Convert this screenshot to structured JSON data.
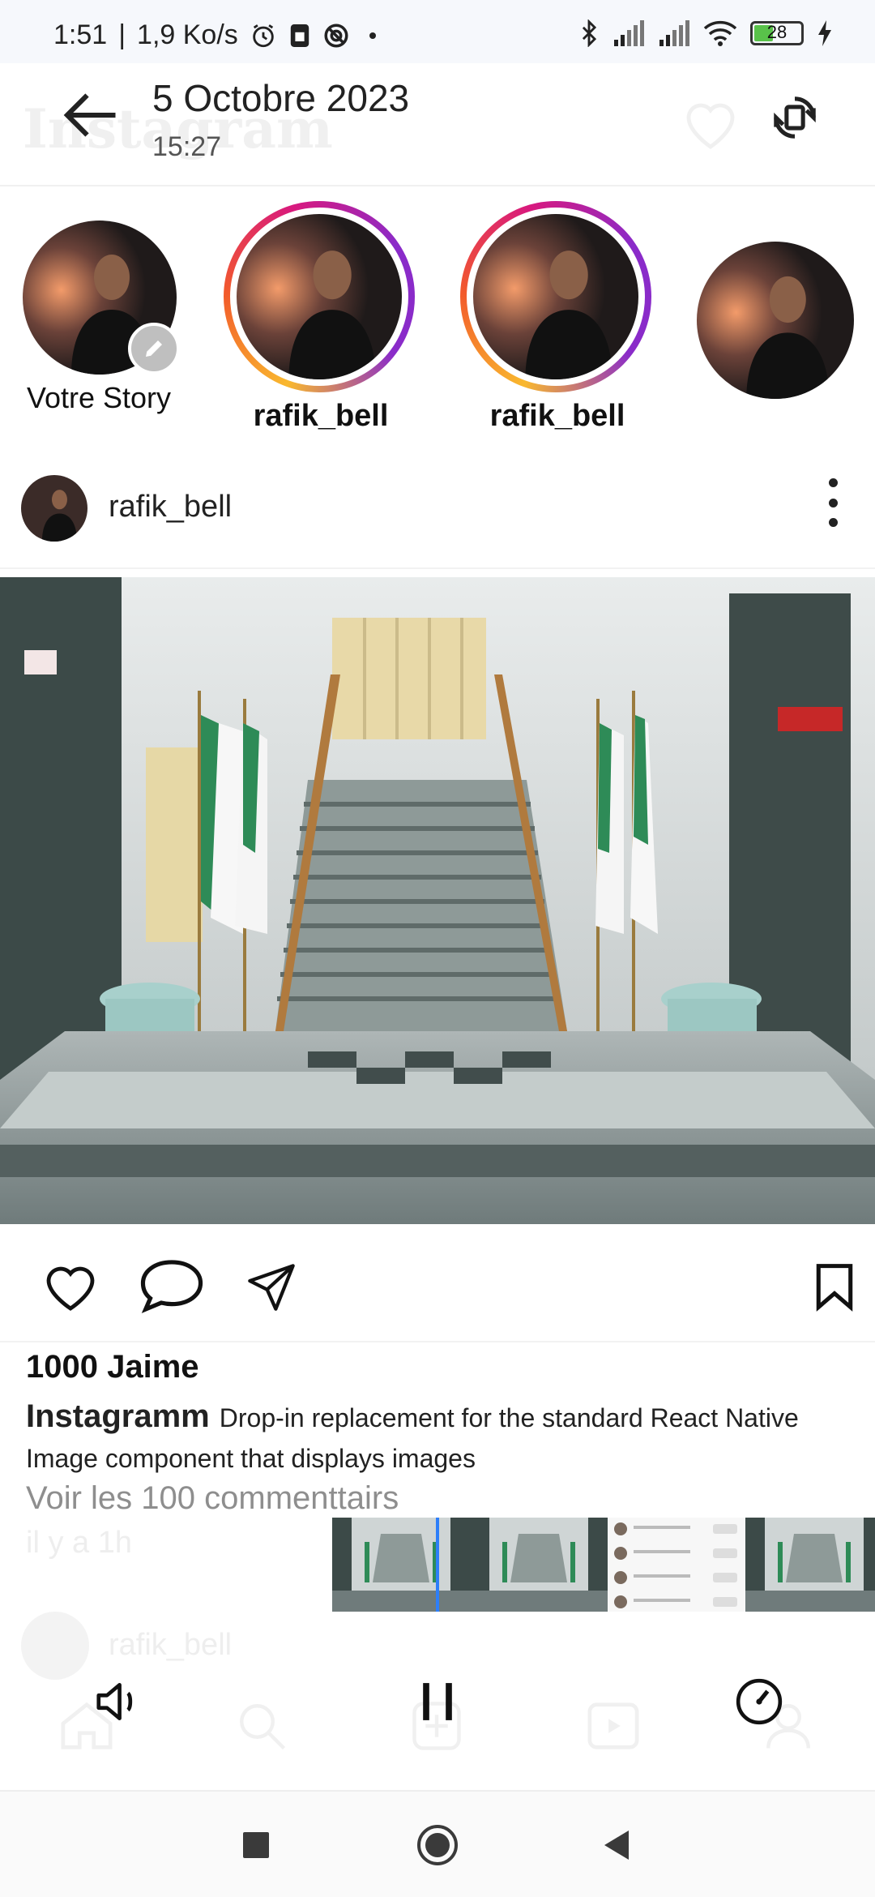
{
  "status_bar": {
    "time": "1:51",
    "network_speed": "1,9 Ko/s",
    "battery_level": "28",
    "icons": [
      "alarm-icon",
      "sim-icon",
      "vpn-icon",
      "dot-icon",
      "bluetooth-icon",
      "signal-icon",
      "signal-icon",
      "wifi-icon",
      "battery-icon",
      "charging-icon"
    ]
  },
  "viewer": {
    "date": "5 Octobre 2023",
    "time": "15:27"
  },
  "stories": [
    {
      "label": "Votre Story",
      "has_ring": false,
      "own": true
    },
    {
      "label": "rafik_bell",
      "has_ring": true
    },
    {
      "label": "rafik_bell",
      "has_ring": true
    },
    {
      "label": "",
      "has_ring": false
    }
  ],
  "post": {
    "username": "rafik_bell",
    "likes": "1000 Jaime",
    "caption_user": "Instagramm",
    "caption_text": "Drop-in replacement for the standard React Native Image component that displays images",
    "comments_link": "Voir les 100 commenttairs",
    "posted_ago": "il y a 1h"
  },
  "next_post": {
    "username": "rafik_bell"
  },
  "colors": {
    "story_ring": [
      "#f9b82e",
      "#f25a2b",
      "#d8197e",
      "#8a2bc9"
    ],
    "playhead": "#2d7ff9",
    "battery_fill": "#59c24a"
  }
}
